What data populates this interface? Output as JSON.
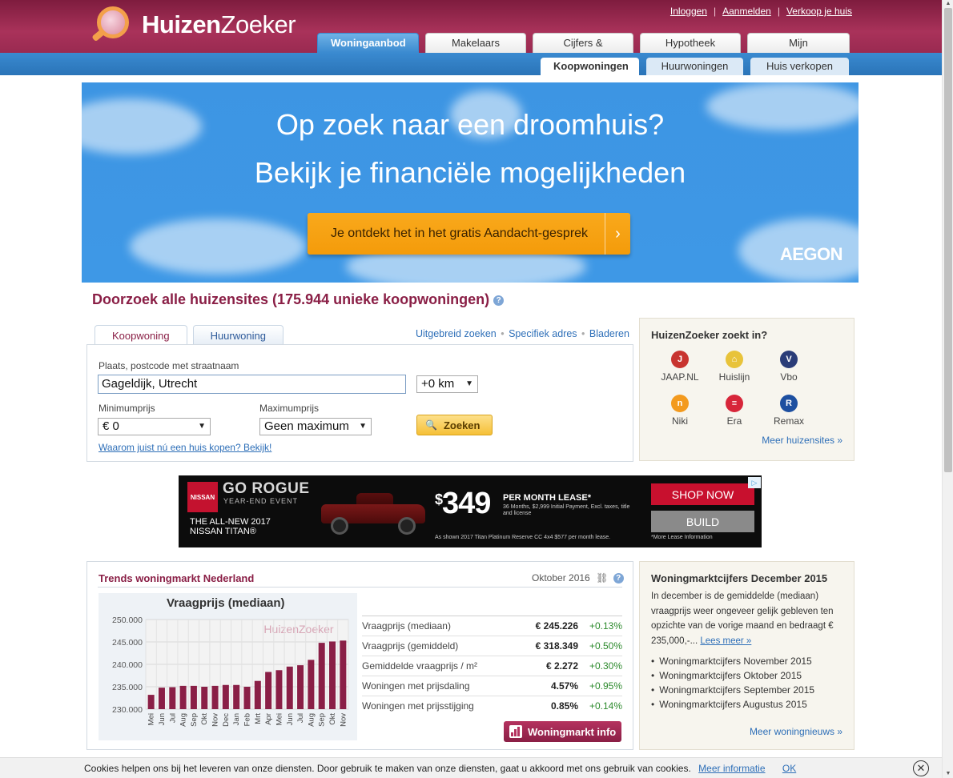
{
  "header": {
    "logo_bold": "Huizen",
    "logo_light": "Zoeker",
    "links": [
      "Inloggen",
      "Aanmelden",
      "Verkoop je huis"
    ],
    "main_tabs": [
      "Woningaanbod",
      "Makelaars",
      "Cijfers & Trends",
      "Hypotheek",
      "Mijn HuizenZoeker"
    ],
    "sub_tabs": [
      "Koopwoningen",
      "Huurwoningen",
      "Huis verkopen"
    ]
  },
  "banner": {
    "line1": "Op zoek naar een droomhuis?",
    "line2": "Bekijk je financiële mogelijkheden",
    "cta": "Je ontdekt het in het gratis Aandacht-gesprek",
    "cta_arrow": "›",
    "brand": "AEGON"
  },
  "search": {
    "title": "Doorzoek alle huizensites (175.944 unieke koopwoningen)",
    "help": "?",
    "tabs": [
      "Koopwoning",
      "Huurwoning"
    ],
    "links": [
      "Uitgebreid zoeken",
      "Specifiek adres",
      "Bladeren"
    ],
    "place_label": "Plaats, postcode met straatnaam",
    "place_value": "Gageldijk, Utrecht",
    "radius_value": "+0 km",
    "min_label": "Minimumprijs",
    "min_value": "€ 0",
    "max_label": "Maximumprijs",
    "max_value": "Geen maximum",
    "submit": "Zoeken",
    "why_link": "Waarom juist nú een huis kopen? Bekijk!"
  },
  "sites_box": {
    "title": "HuizenZoeker zoekt in?",
    "sites": [
      {
        "name": "JAAP.NL",
        "color": "#c8342f",
        "glyph": "J"
      },
      {
        "name": "Huislijn",
        "color": "#e8c33a",
        "glyph": "⌂"
      },
      {
        "name": "Vbo",
        "color": "#2a3c78",
        "glyph": "V"
      },
      {
        "name": "Niki",
        "color": "#f39a1e",
        "glyph": "n"
      },
      {
        "name": "Era",
        "color": "#d7263a",
        "glyph": "≡"
      },
      {
        "name": "Remax",
        "color": "#1d4fa0",
        "glyph": "R"
      }
    ],
    "more": "Meer huizensites »"
  },
  "ad": {
    "brand": "NISSAN",
    "headline": "GO ROGUE",
    "subhead": "YEAR-END EVENT",
    "model_line1": "THE ALL-NEW 2017",
    "model_line2": "NISSAN TITAN®",
    "price": "349",
    "price_symbol": "$",
    "lease": "PER MONTH LEASE*",
    "fine": "36 Months, $2,999 Initial Payment, Excl. taxes, title and license",
    "fine2": "As shown 2017 Titan Platinum Reserve CC 4x4 $577 per month lease.",
    "shop": "SHOP NOW",
    "build": "BUILD",
    "lease_info": "*More Lease Information"
  },
  "trends": {
    "title": "Trends woningmarkt Nederland",
    "date": "Oktober 2016",
    "button": "Woningmarkt info",
    "stats": [
      {
        "name": "Vraagprijs (mediaan)",
        "value": "€ 245.226",
        "change": "+0.13%"
      },
      {
        "name": "Vraagprijs (gemiddeld)",
        "value": "€ 318.349",
        "change": "+0.50%"
      },
      {
        "name": "Gemiddelde vraagprijs / m²",
        "value": "€ 2.272",
        "change": "+0.30%"
      },
      {
        "name": "Woningen met prijsdaling",
        "value": "4.57%",
        "change": "+0.95%"
      },
      {
        "name": "Woningen met prijsstijging",
        "value": "0.85%",
        "change": "+0.14%"
      }
    ]
  },
  "news": {
    "title": "Woningmarktcijfers December 2015",
    "text": "In december is de gemiddelde (mediaan) vraagprijs weer ongeveer gelijk gebleven ten opzichte van de vorige maand en bedraagt € 235,000,-...",
    "read_more": "Lees meer »",
    "items": [
      "Woningmarktcijfers November 2015",
      "Woningmarktcijfers Oktober 2015",
      "Woningmarktcijfers September 2015",
      "Woningmarktcijfers Augustus 2015"
    ],
    "more": "Meer woningnieuws »"
  },
  "cookie": {
    "text": "Cookies helpen ons bij het leveren van onze diensten. Door gebruik te maken van onze diensten, gaat u akkoord met ons gebruik van cookies.",
    "more": "Meer informatie",
    "ok": "OK",
    "close": "✕"
  },
  "chart_data": {
    "type": "bar",
    "title": "Vraagprijs (mediaan)",
    "watermark": "HuizenZoeker",
    "categories": [
      "Mei",
      "Jun",
      "Jul",
      "Aug",
      "Sep",
      "Okt",
      "Nov",
      "Dec",
      "Jan",
      "Feb",
      "Mrt",
      "Apr",
      "Mei",
      "Jun",
      "Jul",
      "Aug",
      "Sep",
      "Okt",
      "Nov"
    ],
    "values": [
      233.2,
      234.8,
      234.9,
      235.2,
      235.2,
      235.0,
      235.2,
      235.4,
      235.4,
      235.0,
      236.3,
      238.3,
      238.7,
      239.5,
      239.8,
      241.0,
      244.8,
      245.1,
      245.3
    ],
    "ylim": [
      230,
      250
    ],
    "yticks": [
      "230.000",
      "235.000",
      "240.000",
      "245.000",
      "250.000"
    ],
    "grid": true,
    "colors": {
      "bar": "#8a1f46"
    }
  }
}
